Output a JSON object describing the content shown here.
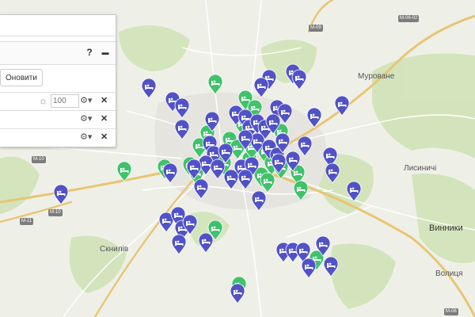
{
  "toolbar": {
    "help_label": "?",
    "collapse_label": "▬",
    "refresh_label": "Оновити"
  },
  "search": {
    "value": "",
    "placeholder": ""
  },
  "layers": [
    {
      "show_opacity": true,
      "opacity_placeholder": "100"
    },
    {
      "show_opacity": false
    },
    {
      "show_opacity": false
    }
  ],
  "place_labels": [
    {
      "id": "murovane",
      "text": "Муроване"
    },
    {
      "id": "lysynychi",
      "text": "Лисиничі"
    },
    {
      "id": "vynnyky",
      "text": "Винники"
    },
    {
      "id": "sknyliv",
      "text": "Скнилів"
    },
    {
      "id": "volytsia",
      "text": "Волиця"
    }
  ],
  "road_labels": [
    {
      "id": "m0602",
      "text": "М-06-02"
    },
    {
      "id": "m09",
      "text": "М-09"
    },
    {
      "id": "m10a",
      "text": "М-10"
    },
    {
      "id": "m10b",
      "text": "М-10"
    },
    {
      "id": "m11",
      "text": "М-11"
    },
    {
      "id": "m06",
      "text": "М-06"
    }
  ],
  "colors": {
    "hotel_marker": "#5252c8",
    "green_marker": "#3fc26a",
    "map_bg": "#eef0e8",
    "park": "#cfe3b5",
    "road_major": "#ffffff",
    "road_minor": "#f4dfa6"
  },
  "marker_icon": "bed-icon"
}
